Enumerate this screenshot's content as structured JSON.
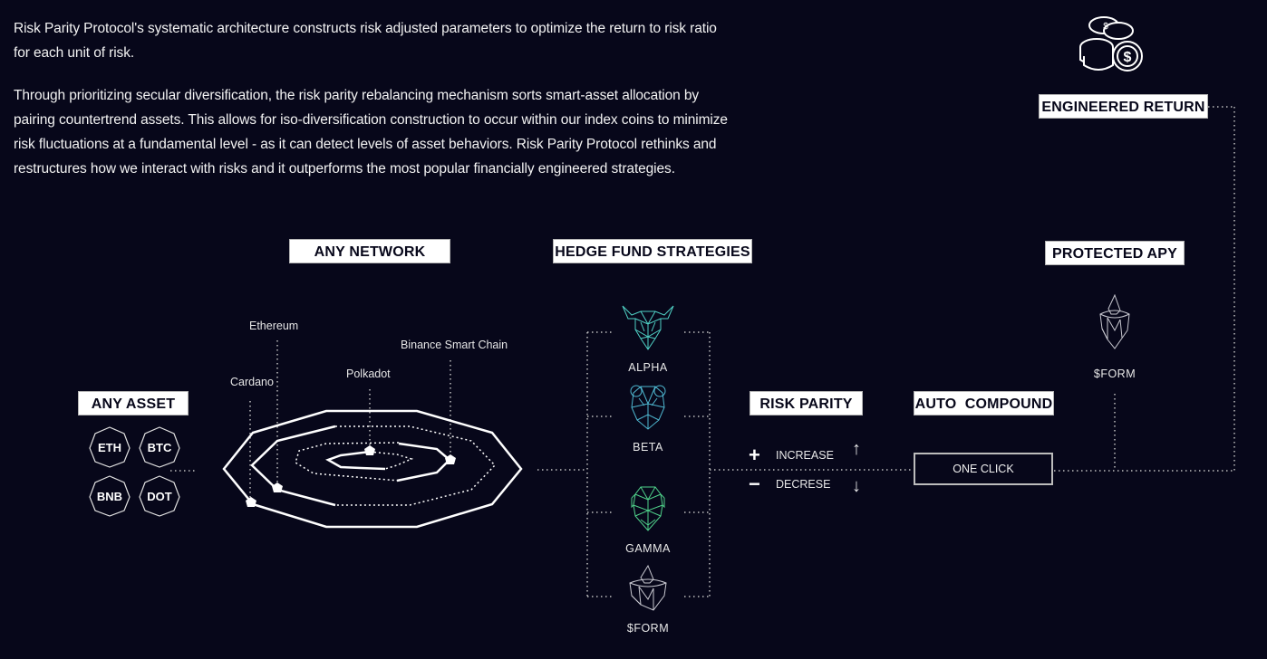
{
  "intro": {
    "paragraphs": [
      "Risk Parity Protocol's systematic architecture constructs risk adjusted parameters to optimize the return to risk ratio for each unit of risk.",
      "Through prioritizing secular diversification, the risk parity rebalancing mechanism sorts smart-asset allocation by pairing countertrend assets. This allows for iso-diversification construction to occur within our index coins to minimize risk fluctuations at a fundamental level - as it can detect levels of asset behaviors. Risk Parity Protocol rethinks and restructures how we interact with risks and it outperforms the most popular financially engineered strategies."
    ]
  },
  "tags": {
    "any_asset": "ANY ASSET",
    "any_network": "ANY NETWORK",
    "hedge_fund": "HEDGE FUND STRATEGIES",
    "risk_parity": "RISK PARITY",
    "auto_compound": "AUTO  COMPOUND",
    "protected_apy": "PROTECTED APY",
    "engineered_return": "ENGINEERED RETURN"
  },
  "assets": [
    "ETH",
    "BTC",
    "BNB",
    "DOT"
  ],
  "networks": [
    "Ethereum",
    "Binance Smart Chain",
    "Cardano",
    "Polkadot"
  ],
  "strategies": [
    {
      "label": "ALPHA",
      "icon": "bull-icon",
      "color": "#4fd1c5"
    },
    {
      "label": "BETA",
      "icon": "bear-icon",
      "color": "#4fb8d1"
    },
    {
      "label": "GAMMA",
      "icon": "gorilla-icon",
      "color": "#4fd18a"
    },
    {
      "label": "$FORM",
      "icon": "crystal-icon",
      "color": "#c8c8d0"
    }
  ],
  "risk_parity": {
    "increase": "INCREASE",
    "decrease": "DECRESE",
    "plus": "+",
    "minus": "−",
    "up": "↑",
    "down": "↓"
  },
  "auto_compound": {
    "button": "ONE CLICK"
  },
  "protected": {
    "token": "$FORM"
  }
}
